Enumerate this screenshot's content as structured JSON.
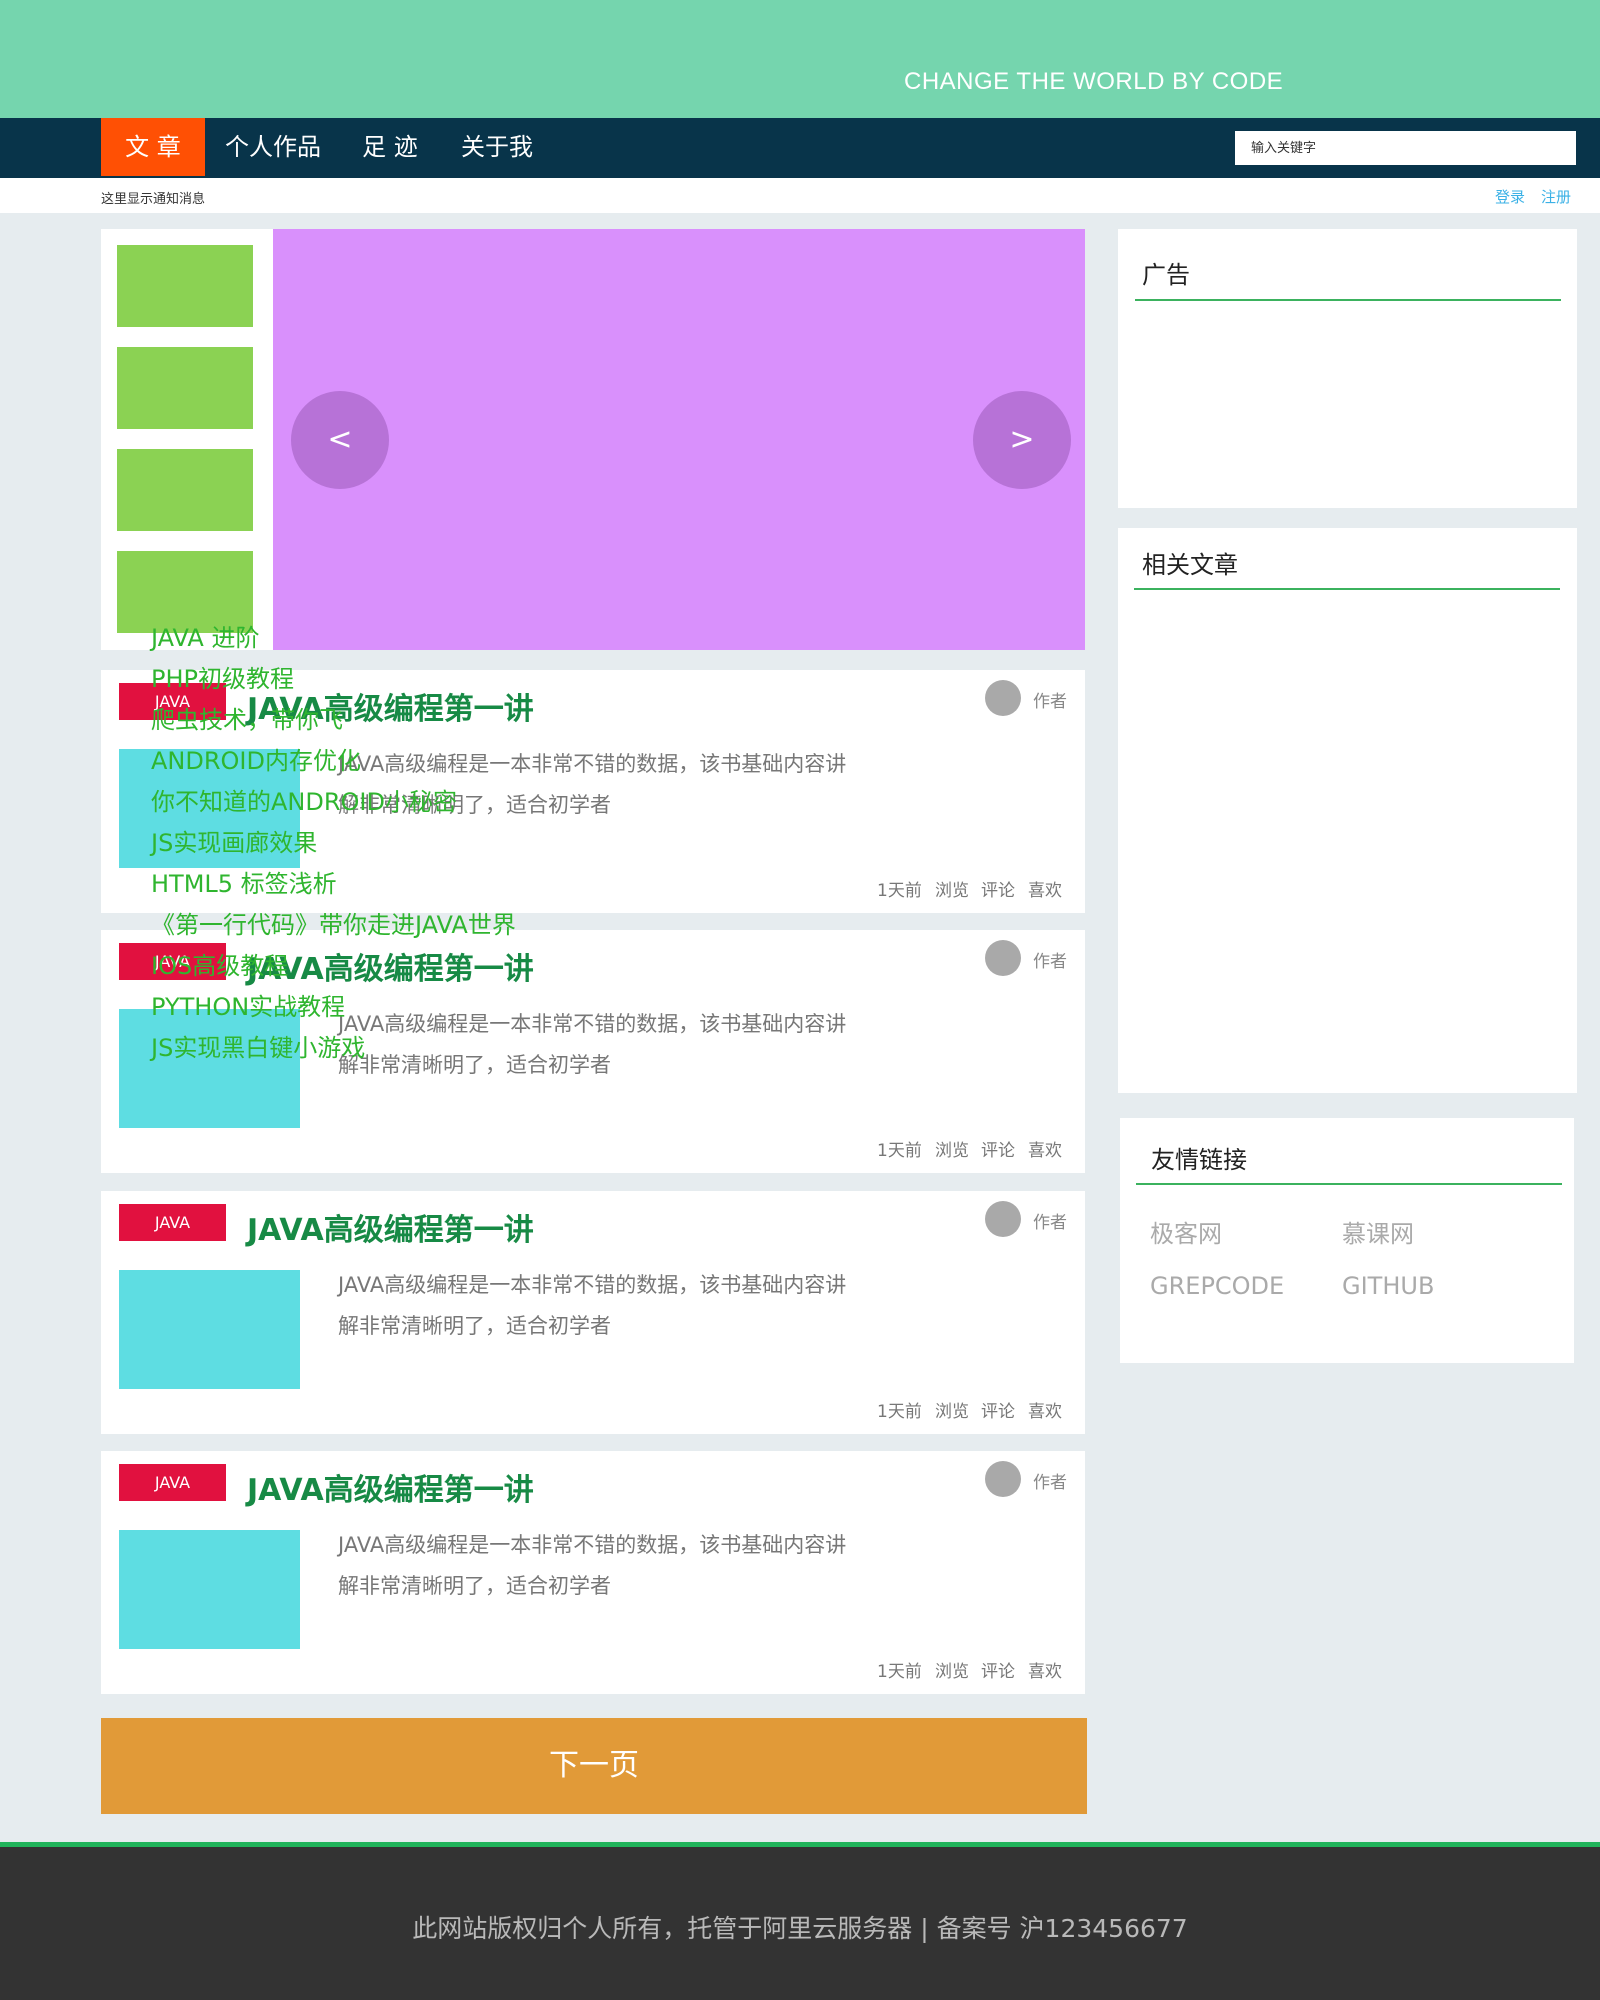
{
  "header": {
    "slogan": "CHANGE THE WORLD BY CODE"
  },
  "nav": {
    "items": [
      "文 章",
      "个人作品",
      "足 迹",
      "关于我"
    ],
    "active_index": 0,
    "search_placeholder": "输入关键字"
  },
  "notice": {
    "text": "这里显示通知消息",
    "login": "登录",
    "register": "注册"
  },
  "slider": {
    "prev": "<",
    "next": ">"
  },
  "articles": [
    {
      "tag": "JAVA",
      "title": "JAVA高级编程第一讲",
      "author": "作者",
      "desc": "JAVA高级编程是一本非常不错的数据，该书基础内容讲解非常清晰明了，适合初学者",
      "time": "1天前",
      "views": "浏览",
      "comments": "评论",
      "likes": "喜欢"
    },
    {
      "tag": "JAVA",
      "title": "JAVA高级编程第一讲",
      "author": "作者",
      "desc": "JAVA高级编程是一本非常不错的数据，该书基础内容讲解非常清晰明了，适合初学者",
      "time": "1天前",
      "views": "浏览",
      "comments": "评论",
      "likes": "喜欢"
    },
    {
      "tag": "JAVA",
      "title": "JAVA高级编程第一讲",
      "author": "作者",
      "desc": "JAVA高级编程是一本非常不错的数据，该书基础内容讲解非常清晰明了，适合初学者",
      "time": "1天前",
      "views": "浏览",
      "comments": "评论",
      "likes": "喜欢"
    },
    {
      "tag": "JAVA",
      "title": "JAVA高级编程第一讲",
      "author": "作者",
      "desc": "JAVA高级编程是一本非常不错的数据，该书基础内容讲解非常清晰明了，适合初学者",
      "time": "1天前",
      "views": "浏览",
      "comments": "评论",
      "likes": "喜欢"
    }
  ],
  "pagination": {
    "next_label": "下一页"
  },
  "sidebar": {
    "ad_title": "广告",
    "related_title": "相关文章",
    "related_links": [
      "JAVA 进阶",
      "PHP初级教程",
      "爬虫技术，带你飞",
      "ANDROID内存优化",
      "你不知道的ANDROID小秘密",
      "JS实现画廊效果",
      "HTML5 标签浅析",
      "《第一行代码》带你走进JAVA世界",
      "IOS高级教程",
      "PYTHON实战教程",
      "JS实现黑白键小游戏"
    ],
    "friends_title": "友情链接",
    "friend_links": [
      "极客网",
      "慕课网",
      "GREPCODE",
      "GITHUB"
    ]
  },
  "footer": {
    "text": "此网站版权归个人所有，托管于阿里云服务器 | 备案号 沪123456677"
  },
  "colors": {
    "banner": "#75d5ae",
    "nav_bg": "#08344a",
    "nav_active": "#ff5004",
    "tag": "#e1113f",
    "title_green": "#178a45",
    "link_green": "#2fb52f",
    "slide": "#d990fc",
    "thumb": "#8bd253",
    "article_image": "#5edde2",
    "next_button": "#e19a38",
    "footer": "#333333"
  }
}
